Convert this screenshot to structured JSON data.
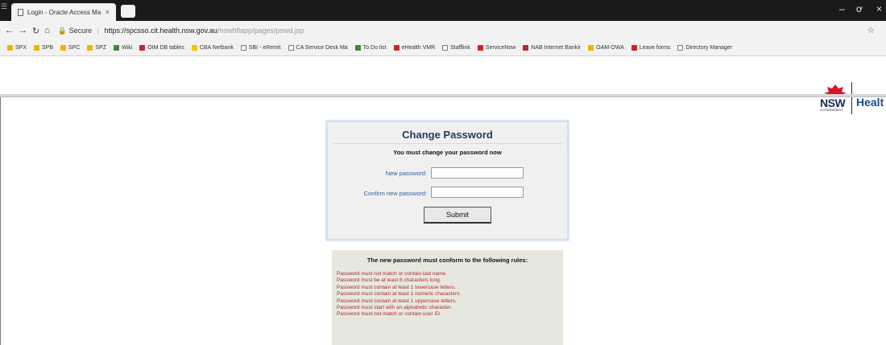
{
  "browser": {
    "tab_title": "Login - Oracle Access Ma",
    "tab_close": "×",
    "url_secure_label": "Secure",
    "url_main": "https://spcsso.cit.health.nsw.gov.au",
    "url_path": "/nswhflapp/pages/pswd.jsp",
    "window_controls": {
      "minimize": "–",
      "maximize": "ơ",
      "close": "×"
    },
    "bookmarks": [
      {
        "label": "SPX",
        "color": "#f2b200"
      },
      {
        "label": "SPB",
        "color": "#f2b200"
      },
      {
        "label": "SPC",
        "color": "#f2b200"
      },
      {
        "label": "SPZ",
        "color": "#f2b200"
      },
      {
        "label": "Wiki",
        "color": "#3a8a3a"
      },
      {
        "label": "OIM DB tables",
        "color": "#c0282d"
      },
      {
        "label": "CBA Netbank",
        "color": "#f2c500"
      },
      {
        "label": "SBI - eRemit",
        "color": "#ffffff"
      },
      {
        "label": "CA Service Desk Ma",
        "color": "#ffffff"
      },
      {
        "label": "To Do list",
        "color": "#3a8a3a"
      },
      {
        "label": "eHealth VMR",
        "color": "#c0282d"
      },
      {
        "label": "Stafflink",
        "color": "#ffffff"
      },
      {
        "label": "ServiceNow",
        "color": "#d62020"
      },
      {
        "label": "NAB Internet Bankir",
        "color": "#c0282d"
      },
      {
        "label": "OAM-OWA",
        "color": "#f2b200"
      },
      {
        "label": "Leave forms",
        "color": "#d62020"
      },
      {
        "label": "Directory Manager",
        "color": "#ffffff"
      }
    ]
  },
  "logo": {
    "nsw": "NSW",
    "government": "GOVERNMENT",
    "health": "Healt"
  },
  "form": {
    "title": "Change Password",
    "subtitle": "You must change your password now",
    "new_password_label": "New password:",
    "confirm_password_label": "Confirm new password:",
    "new_password_value": "",
    "confirm_password_value": "",
    "submit_label": "Submit"
  },
  "rules": {
    "title": "The new password must conform to the following rules:",
    "items": [
      "Password must not match or contain last name.",
      "Password must be at least 8 characters long.",
      "Password must contain at least 1 lowercase letters.",
      "Password must contain at least 1 numeric characters.",
      "Password must contain at least 1 uppercase letters.",
      "Password must start with an alphabetic character.",
      "Password must not match or contain user ID."
    ]
  },
  "colors": {
    "accent": "#2f5f9f",
    "rule_text": "#b02a2a",
    "title": "#1f3a5f"
  }
}
